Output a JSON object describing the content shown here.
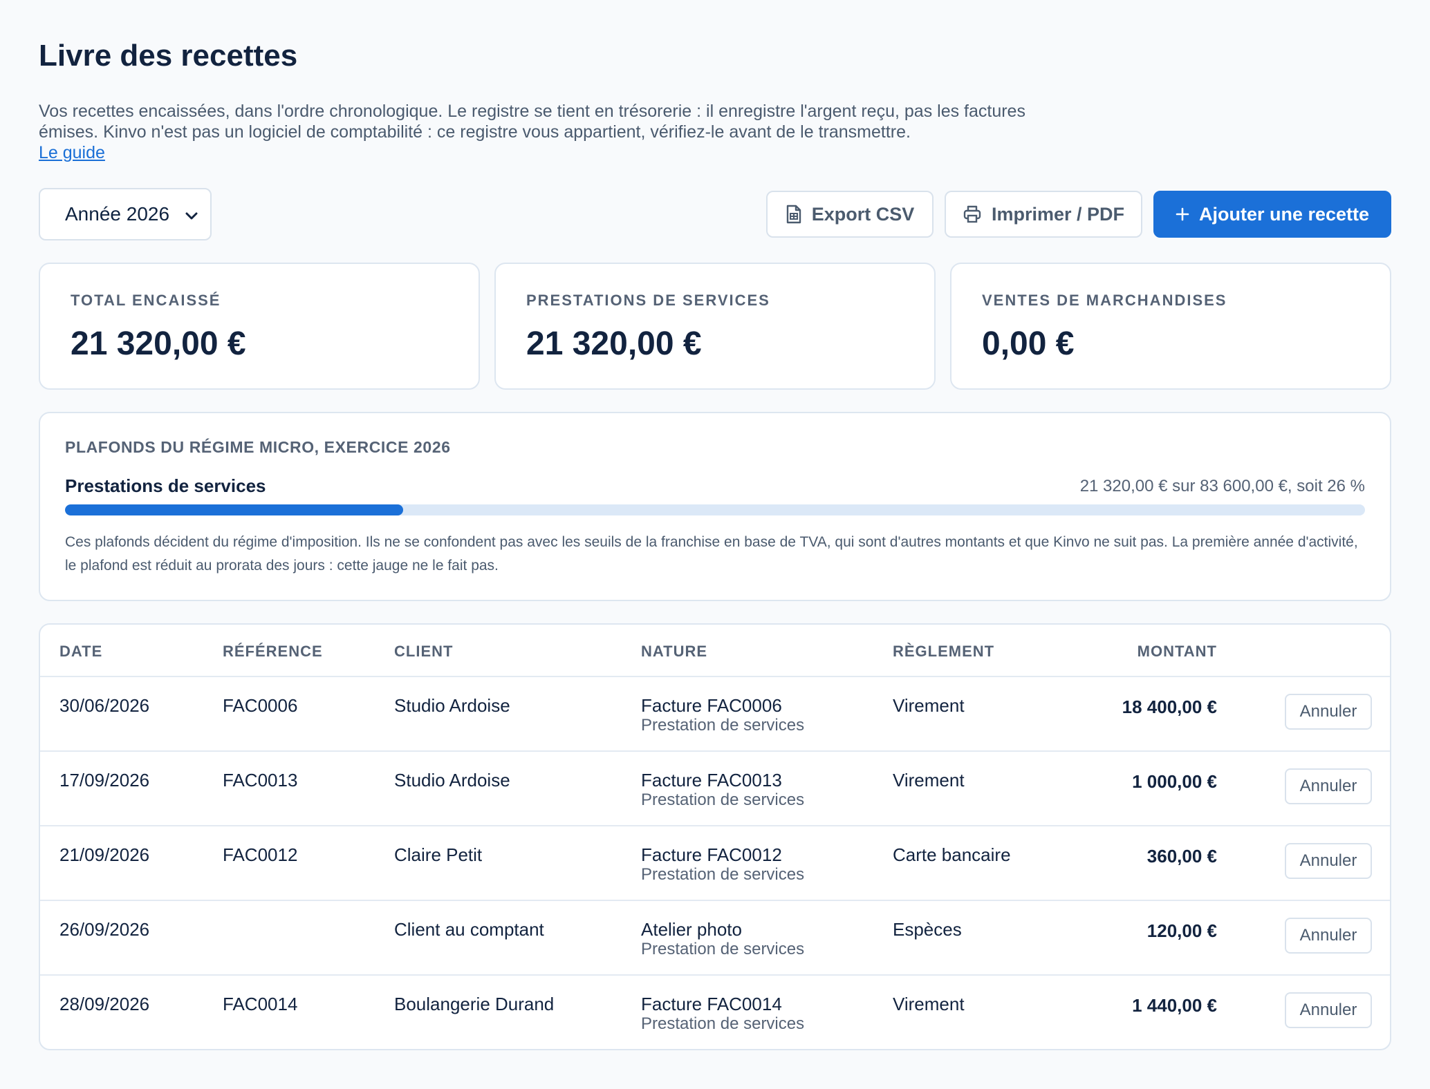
{
  "page": {
    "title": "Livre des recettes",
    "intro": "Vos recettes encaissées, dans l'ordre chronologique. Le registre se tient en trésorerie : il enregistre l'argent reçu, pas les factures émises. Kinvo n'est pas un logiciel de comptabilité : ce registre vous appartient, vérifiez-le avant de le transmettre.",
    "guide_link": "Le guide"
  },
  "toolbar": {
    "year_value": "Année 2026",
    "export_label": "Export CSV",
    "print_label": "Imprimer / PDF",
    "add_label": "Ajouter une recette"
  },
  "stats": [
    {
      "label": "TOTAL ENCAISSÉ",
      "value": "21 320,00 €"
    },
    {
      "label": "PRESTATIONS DE SERVICES",
      "value": "21 320,00 €"
    },
    {
      "label": "VENTES DE MARCHANDISES",
      "value": "0,00 €"
    }
  ],
  "plafond": {
    "title": "PLAFONDS DU RÉGIME MICRO, EXERCICE 2026",
    "subtitle": "Prestations de services",
    "amount_text": "21 320,00 € sur 83 600,00 €, soit 26 %",
    "progress_percent": 26,
    "note": "Ces plafonds décident du régime d'imposition. Ils ne se confondent pas avec les seuils de la franchise en base de TVA, qui sont d'autres montants et que Kinvo ne suit pas. La première année d'activité, le plafond est réduit au prorata des jours : cette jauge ne le fait pas."
  },
  "table": {
    "headers": {
      "date": "DATE",
      "reference": "RÉFÉRENCE",
      "client": "CLIENT",
      "nature": "NATURE",
      "reglement": "RÈGLEMENT",
      "montant": "MONTANT"
    },
    "cancel_label": "Annuler",
    "rows": [
      {
        "date": "30/06/2026",
        "reference": "FAC0006",
        "client": "Studio Ardoise",
        "nature": "Facture FAC0006",
        "nature_sub": "Prestation de services",
        "reglement": "Virement",
        "montant": "18 400,00 €"
      },
      {
        "date": "17/09/2026",
        "reference": "FAC0013",
        "client": "Studio Ardoise",
        "nature": "Facture FAC0013",
        "nature_sub": "Prestation de services",
        "reglement": "Virement",
        "montant": "1 000,00 €"
      },
      {
        "date": "21/09/2026",
        "reference": "FAC0012",
        "client": "Claire Petit",
        "nature": "Facture FAC0012",
        "nature_sub": "Prestation de services",
        "reglement": "Carte bancaire",
        "montant": "360,00 €"
      },
      {
        "date": "26/09/2026",
        "reference": "",
        "client": "Client au comptant",
        "nature": "Atelier photo",
        "nature_sub": "Prestation de services",
        "reglement": "Espèces",
        "montant": "120,00 €"
      },
      {
        "date": "28/09/2026",
        "reference": "FAC0014",
        "client": "Boulangerie Durand",
        "nature": "Facture FAC0014",
        "nature_sub": "Prestation de services",
        "reglement": "Virement",
        "montant": "1 440,00 €"
      }
    ]
  },
  "colors": {
    "accent": "#1b70d8",
    "text_dark": "#12233f",
    "text_muted": "#556275",
    "border": "#dde6f0",
    "progress_track": "#dbe8f7"
  }
}
